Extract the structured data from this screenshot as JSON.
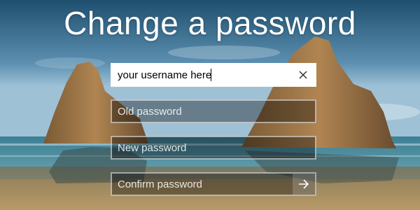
{
  "page": {
    "title": "Change a password"
  },
  "form": {
    "username": {
      "value": "your username here"
    },
    "old_password": {
      "placeholder": "Old password"
    },
    "new_password": {
      "placeholder": "New password"
    },
    "confirm_password": {
      "placeholder": "Confirm password"
    }
  },
  "icons": {
    "clear": "close-icon",
    "submit": "arrow-right-icon"
  },
  "colors": {
    "field_border": "#FFFFFF",
    "active_field_bg": "#FFFFFF",
    "active_text": "#000000",
    "inactive_text": "#FFFFFF"
  }
}
